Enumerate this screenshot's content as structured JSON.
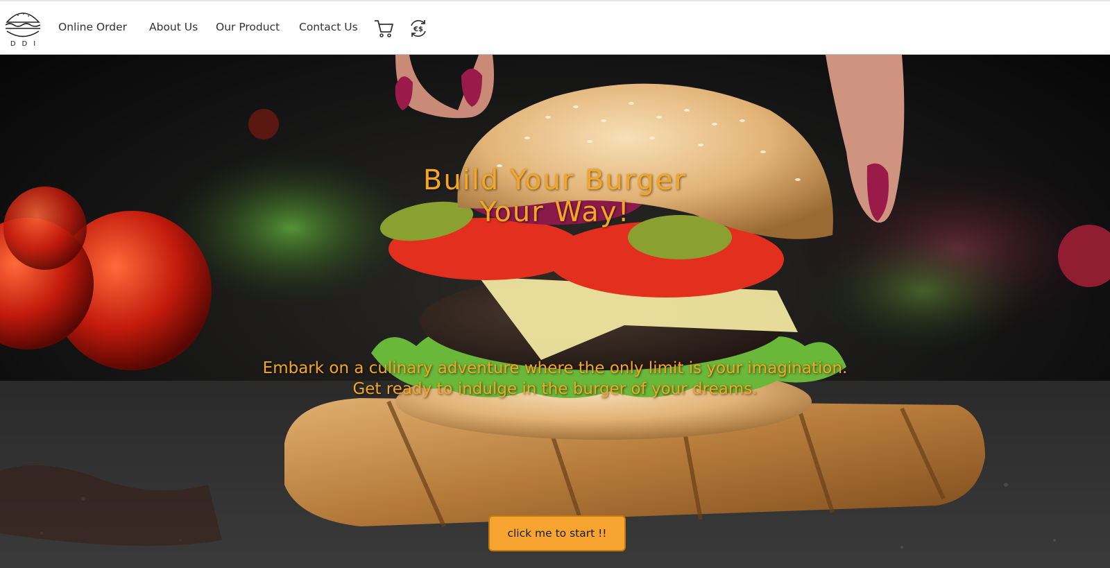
{
  "brand": {
    "logo_text": "DDI"
  },
  "nav": {
    "links": [
      "Online Order",
      "About Us",
      "Our Product",
      "Contact Us"
    ],
    "cart_icon": "cart-icon",
    "currency_icon": "currency-exchange-icon",
    "currency_label": "€$"
  },
  "hero": {
    "title_line1": "Build Your Burger",
    "title_line2": "Your Way!",
    "subtitle_line1": "Embark on a culinary adventure where the only limit is your imagination.",
    "subtitle_line2": "Get ready to indulge in the burger of your dreams.",
    "cta_label": "click me to start !!"
  },
  "colors": {
    "accent": "#f5a623",
    "button": "#f7a530",
    "nav_text": "#333333"
  }
}
